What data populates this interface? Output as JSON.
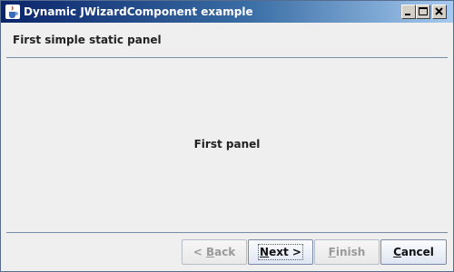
{
  "window": {
    "title": "Dynamic JWizardComponent example"
  },
  "icons": {
    "app": "java-cup-icon",
    "minimize": "minimize-icon",
    "maximize": "maximize-icon",
    "close": "close-icon"
  },
  "wizard": {
    "header": "First simple static panel",
    "panel_text": "First panel"
  },
  "buttons": {
    "back": {
      "prefix": "< ",
      "mnemonic": "B",
      "rest": "ack",
      "enabled": false
    },
    "next": {
      "mnemonic": "N",
      "rest": "ext >",
      "enabled": true
    },
    "finish": {
      "mnemonic": "F",
      "rest": "inish",
      "enabled": false
    },
    "cancel": {
      "mnemonic": "C",
      "rest": "ancel",
      "enabled": true
    }
  },
  "colors": {
    "titlebar_start": "#0a246a",
    "titlebar_end": "#a6caf0",
    "separator": "#7a8ca8"
  }
}
